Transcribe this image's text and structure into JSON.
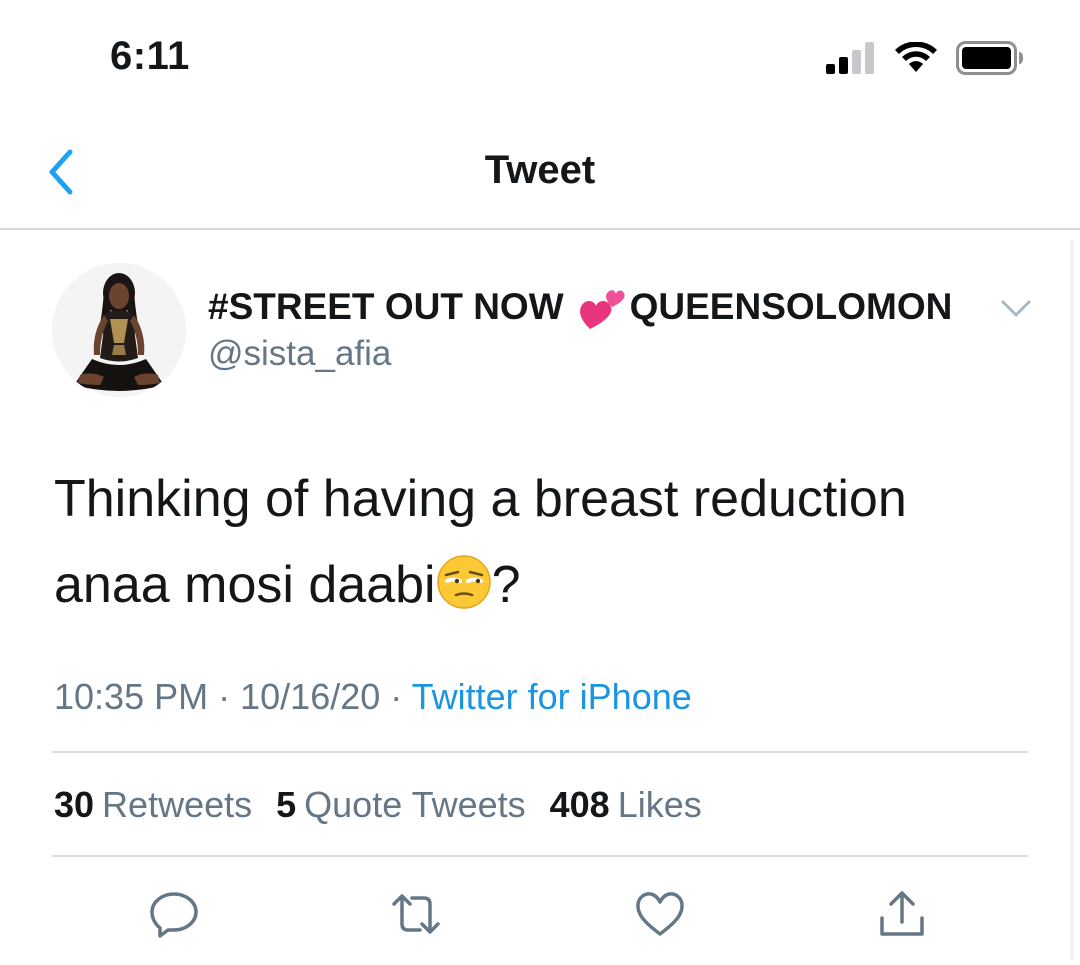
{
  "status_bar": {
    "time": "6:11",
    "icons": [
      "cellular-signal-icon",
      "wifi-icon",
      "battery-icon"
    ]
  },
  "nav": {
    "title": "Tweet",
    "back_icon": "chevron-left-icon"
  },
  "tweet": {
    "display_name_part1": "#STREET OUT NOW",
    "display_name_emoji": "two-hearts-emoji",
    "display_name_part2": "QUEENSOLOMON",
    "handle": "@sista_afia",
    "text_line1": "Thinking of having a breast reduction",
    "text_line2_prefix": "anaa mosi daabi",
    "text_emoji": "unamused-face-emoji",
    "text_line2_suffix": "?",
    "time": "10:35 PM",
    "date": "10/16/20",
    "separator": "·",
    "source": "Twitter for iPhone"
  },
  "stats": {
    "retweets_count": "30",
    "retweets_label": "Retweets",
    "quotes_count": "5",
    "quotes_label": "Quote Tweets",
    "likes_count": "408",
    "likes_label": "Likes"
  },
  "actions": [
    "reply-icon",
    "retweet-icon",
    "like-icon",
    "share-icon"
  ],
  "colors": {
    "accent": "#1da1f2",
    "link": "#1b95e0",
    "secondary_text": "#657786",
    "primary_text": "#14171a",
    "divider": "#d9dee2"
  }
}
